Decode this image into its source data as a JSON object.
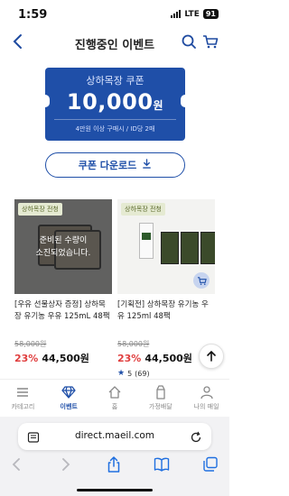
{
  "status_bar": {
    "time": "1:59",
    "network": "LTE",
    "battery": "91"
  },
  "header": {
    "title": "진행중인 이벤트"
  },
  "coupon": {
    "name": "상하목장 쿠폰",
    "amount": "10,000",
    "unit": "원",
    "condition": "4만원 이상 구매시 / ID당 2매",
    "download_label": "쿠폰 다운로드"
  },
  "products": [
    {
      "tag": "상하목장 전청",
      "soldout_line1": "준비된 수량이",
      "soldout_line2": "소진되었습니다.",
      "name": "[우유 선물상자 증정] 상하목장 유기농 우유 125mL 48팩",
      "original_price": "58,000원",
      "discount": "23%",
      "price": "44,500원"
    },
    {
      "tag": "상하목장 전청",
      "name": "[기획전] 상하목장 유기농 우유 125ml 48팩",
      "original_price": "58,000원",
      "discount": "23%",
      "price": "44,500원",
      "rating": "5",
      "reviews": "(69)"
    }
  ],
  "nav": {
    "items": [
      {
        "label": "카테고리"
      },
      {
        "label": "이벤트"
      },
      {
        "label": "홈"
      },
      {
        "label": "가정배달"
      },
      {
        "label": "나의 매일"
      }
    ],
    "active_index": 1
  },
  "browser": {
    "url": "direct.maeil.com"
  },
  "colors": {
    "brand_blue": "#1f4fa8",
    "discount_red": "#e03e3e"
  }
}
